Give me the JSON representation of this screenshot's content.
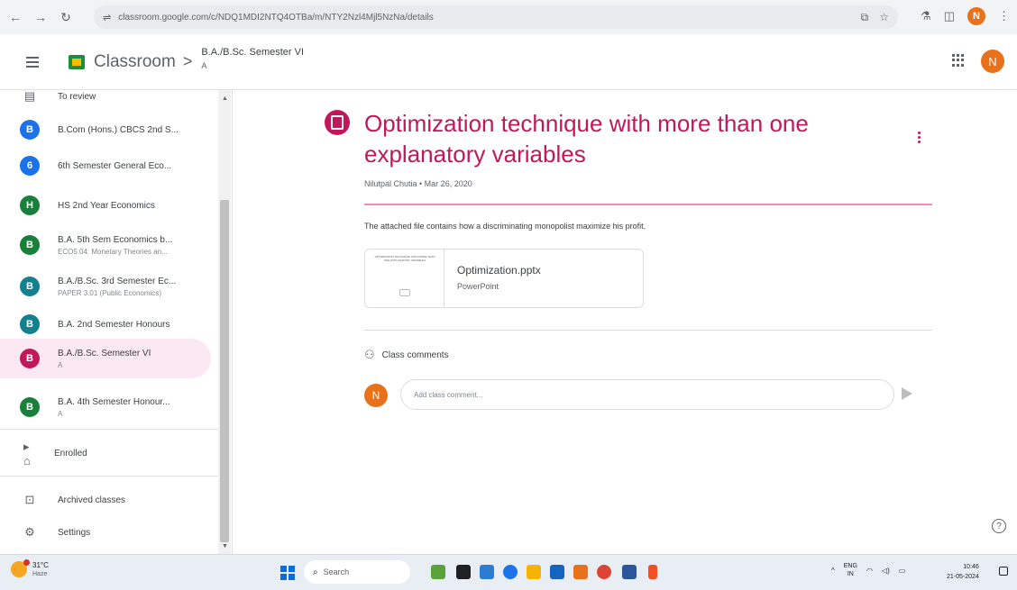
{
  "browser": {
    "url": "classroom.google.com/c/NDQ1MDI2NTQ4OTBa/m/NTY2Nzl4Mjl5NzNa/details",
    "profile_initial": "N"
  },
  "header": {
    "brand": "Classroom",
    "separator": ">",
    "crumb_title": "B.A./B.Sc. Semester VI",
    "crumb_sub": "A",
    "avatar_initial": "N"
  },
  "sidebar": {
    "to_review_label": "To review",
    "classes": [
      {
        "initial": "B",
        "title": "B.Com (Hons.) CBCS 2nd S...",
        "subtitle": "",
        "color": "#1a73e8"
      },
      {
        "initial": "6",
        "title": "6th Semester General Eco...",
        "subtitle": "",
        "color": "#1a73e8"
      },
      {
        "initial": "H",
        "title": "HS 2nd Year Economics",
        "subtitle": "",
        "color": "#188038"
      },
      {
        "initial": "B",
        "title": "B.A. 5th Sem Economics b...",
        "subtitle": "ECO5.04: Monetary Theories an...",
        "color": "#188038"
      },
      {
        "initial": "B",
        "title": "B.A./B.Sc. 3rd Semester Ec...",
        "subtitle": "PAPER 3.01 (Public Economics)",
        "color": "#12808f"
      },
      {
        "initial": "B",
        "title": "B.A. 2nd Semester Honours",
        "subtitle": "",
        "color": "#12808f"
      },
      {
        "initial": "B",
        "title": "B.A./B.Sc. Semester VI",
        "subtitle": "A",
        "color": "#c2185b",
        "active": true
      },
      {
        "initial": "B",
        "title": "B.A. 4th Semester Honour...",
        "subtitle": "A",
        "color": "#188038"
      }
    ],
    "enrolled_label": "Enrolled",
    "archived_label": "Archived classes",
    "settings_label": "Settings"
  },
  "post": {
    "title": "Optimization technique with more than one explanatory variables",
    "author_date": "Nilutpal Chutia • Mar 26, 2020",
    "body": "The attached file contains how a discriminating monopolist maximize his profit.",
    "attachment": {
      "name": "Optimization.pptx",
      "type": "PowerPoint",
      "thumb_text": "OPTIMIZATION TECHNIQUE WITH MORE THAN ONE EXPLANATORY VARIABLES"
    },
    "comments_label": "Class comments",
    "comment_avatar_initial": "N",
    "comment_placeholder": "Add class comment..."
  },
  "help_label": "?",
  "taskbar": {
    "temperature": "31°C",
    "weather": "Haze",
    "search_placeholder": "Search",
    "language_top": "ENG",
    "language_bottom": "IN",
    "time": "10:46",
    "date": "21-05-2024"
  },
  "colors": {
    "accent": "#c2185b",
    "accent_light": "#fce8f3",
    "divider": "#f48fb1"
  }
}
